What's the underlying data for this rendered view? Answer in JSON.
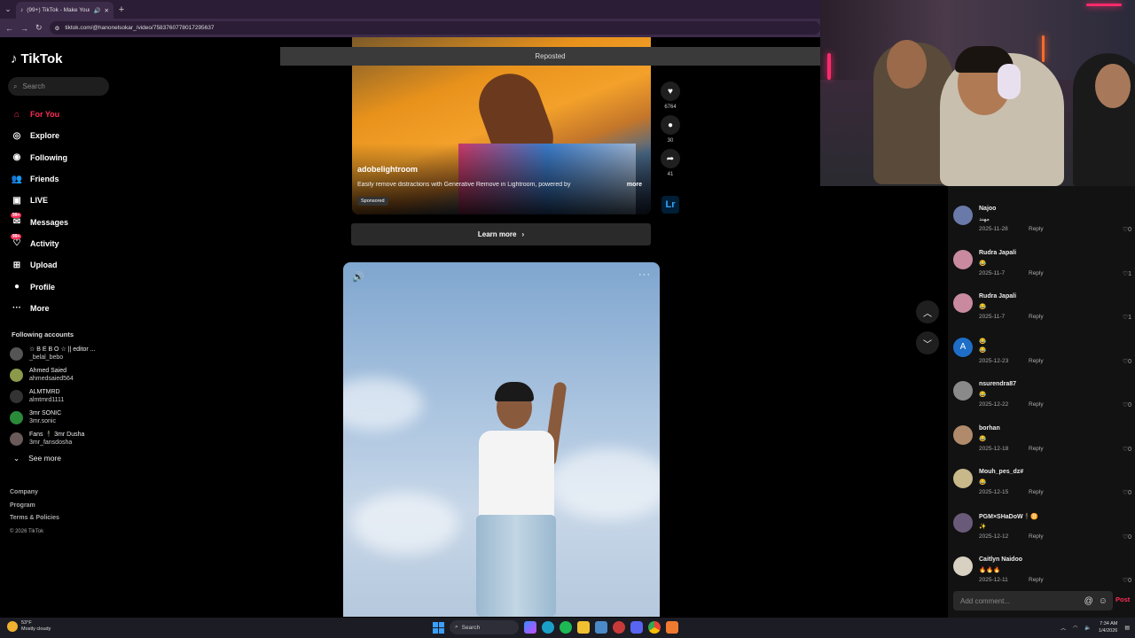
{
  "browser": {
    "tab_title": "(99+) TikTok - Make Your D...",
    "new_tab": "+",
    "url": "tiktok.com/@hanonelsokar_/video/7583760778017295637"
  },
  "sidebar": {
    "logo_text": "TikTok",
    "search_placeholder": "Search",
    "nav": [
      {
        "label": "For You",
        "icon": "home-icon"
      },
      {
        "label": "Explore",
        "icon": "compass-icon"
      },
      {
        "label": "Following",
        "icon": "following-icon"
      },
      {
        "label": "Friends",
        "icon": "friends-icon"
      },
      {
        "label": "LIVE",
        "icon": "live-icon"
      },
      {
        "label": "Messages",
        "icon": "messages-icon",
        "badge": "99+"
      },
      {
        "label": "Activity",
        "icon": "activity-icon",
        "badge": "99+"
      },
      {
        "label": "Upload",
        "icon": "upload-icon"
      },
      {
        "label": "Profile",
        "icon": "profile-icon"
      },
      {
        "label": "More",
        "icon": "more-icon"
      }
    ],
    "following_title": "Following accounts",
    "following": [
      {
        "name": "☆ B E B O ☆ || editor ...",
        "user": "_belal_bebo"
      },
      {
        "name": "Ahmed Saied",
        "user": "ahmedsaied564"
      },
      {
        "name": "ALMTMRD",
        "user": "almtmrd1111"
      },
      {
        "name": "3mr SONIC",
        "user": "3mr.sonic"
      },
      {
        "name": "Fans 🕴 3mr Dusha",
        "user": "3mr_fansdosha"
      }
    ],
    "see_more": "See more",
    "footer": [
      "Company",
      "Program",
      "Terms & Policies"
    ],
    "copyright": "© 2026 TikTok"
  },
  "feed": {
    "reposted": "Reposted",
    "ad": {
      "author": "adobelightroom",
      "description": "Easily remove distractions with Generative Remove in Lightroom, powered by",
      "more": "more",
      "sponsored": "Sponsored",
      "likes": "6764",
      "comments": "30",
      "shares": "41",
      "brand_badge": "Lr"
    },
    "learn_more": "Learn more"
  },
  "comments": [
    {
      "name": "Najoo",
      "text": "مهند",
      "date": "2025-11-28",
      "likes": "0",
      "avatar_color": "#6a7aa8"
    },
    {
      "name": "Rudra Japali",
      "text": "😂",
      "date": "2025-11-7",
      "likes": "1",
      "avatar_color": "#c98aa0"
    },
    {
      "name": "Rudra Japali",
      "text": "😂",
      "date": "2025-11-7",
      "likes": "1",
      "avatar_color": "#c98aa0"
    },
    {
      "name": "",
      "text": "😂 😂",
      "date": "2025-12-23",
      "likes": "0",
      "avatar_letter": "A",
      "avatar_color": "#1e6ec8"
    },
    {
      "name": "nsurendra87",
      "text": "😂",
      "date": "2025-12-22",
      "likes": "0",
      "avatar_color": "#8a8a8a"
    },
    {
      "name": "borhan",
      "text": "😂",
      "date": "2025-12-18",
      "likes": "0",
      "avatar_color": "#b08a6a"
    },
    {
      "name": "Mouh_pes_dz#",
      "text": "😂",
      "date": "2025-12-15",
      "likes": "0",
      "avatar_color": "#c8b88a"
    },
    {
      "name": "PGM×SHaDoW🕴️♊",
      "text": "✨",
      "date": "2025-12-12",
      "likes": "0",
      "avatar_color": "#6a5a7a"
    },
    {
      "name": "Caitlyn Naidoo",
      "text": "🔥🔥🔥",
      "date": "2025-12-11",
      "likes": "0",
      "avatar_color": "#d8d0c0"
    }
  ],
  "reply_label": "Reply",
  "add_comment_placeholder": "Add comment...",
  "post_label": "Post",
  "taskbar": {
    "weather_temp": "53°F",
    "weather_desc": "Mostly cloudy",
    "search": "Search",
    "time": "7:34 AM",
    "date": "1/4/2026"
  },
  "colors": {
    "accent": "#fe2c55",
    "lr_blue": "#31a8ff"
  }
}
